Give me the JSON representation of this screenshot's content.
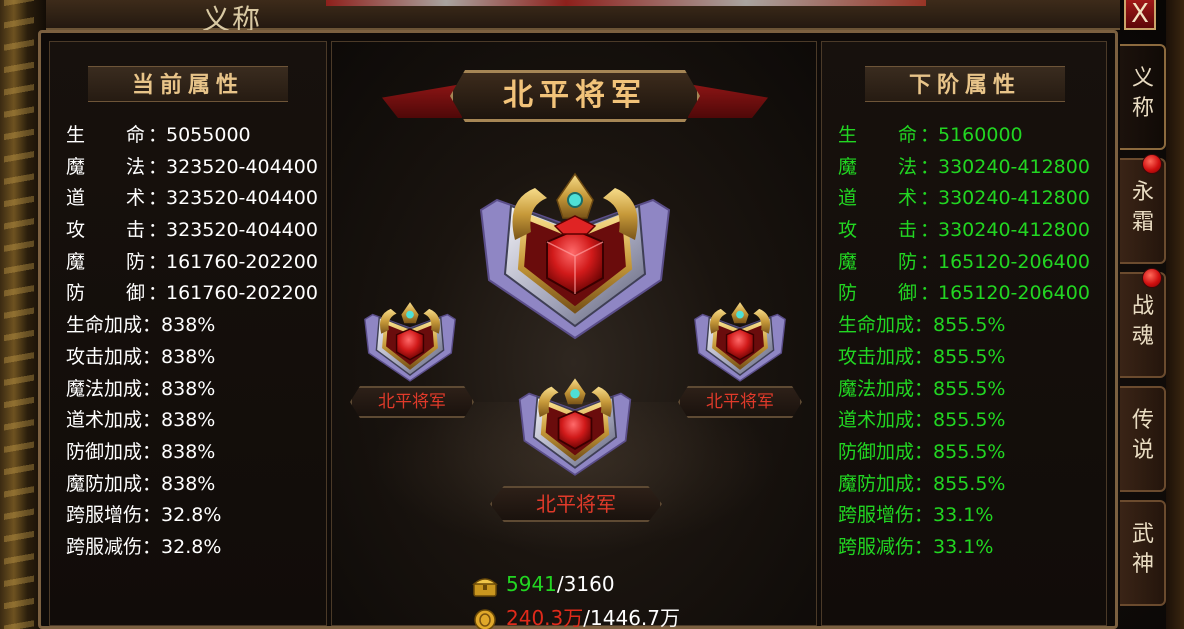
{
  "window": {
    "title": "义称",
    "close_label": "X"
  },
  "current": {
    "header": "当前属性",
    "attrs": [
      {
        "c1": "生",
        "c2": "命",
        "sep": "：",
        "value": "5055000"
      },
      {
        "c1": "魔",
        "c2": "法",
        "sep": "：",
        "value": "323520-404400"
      },
      {
        "c1": "道",
        "c2": "术",
        "sep": "：",
        "value": "323520-404400"
      },
      {
        "c1": "攻",
        "c2": "击",
        "sep": "：",
        "value": "323520-404400"
      },
      {
        "c1": "魔",
        "c2": "防",
        "sep": "：",
        "value": "161760-202200"
      },
      {
        "c1": "防",
        "c2": "御",
        "sep": "：",
        "value": "161760-202200"
      }
    ],
    "bonuses": [
      {
        "label": "生命加成",
        "sep": "：",
        "value": "838%"
      },
      {
        "label": "攻击加成",
        "sep": "：",
        "value": "838%"
      },
      {
        "label": "魔法加成",
        "sep": "：",
        "value": "838%"
      },
      {
        "label": "道术加成",
        "sep": "：",
        "value": "838%"
      },
      {
        "label": "防御加成",
        "sep": "：",
        "value": "838%"
      },
      {
        "label": "魔防加成",
        "sep": "：",
        "value": "838%"
      },
      {
        "label": "跨服增伤",
        "sep": "：",
        "value": "32.8%"
      },
      {
        "label": "跨服减伤",
        "sep": "：",
        "value": "32.8%"
      }
    ]
  },
  "next": {
    "header": "下阶属性",
    "attrs": [
      {
        "c1": "生",
        "c2": "命",
        "sep": "：",
        "value": "5160000"
      },
      {
        "c1": "魔",
        "c2": "法",
        "sep": "：",
        "value": "330240-412800"
      },
      {
        "c1": "道",
        "c2": "术",
        "sep": "：",
        "value": "330240-412800"
      },
      {
        "c1": "攻",
        "c2": "击",
        "sep": "：",
        "value": "330240-412800"
      },
      {
        "c1": "魔",
        "c2": "防",
        "sep": "：",
        "value": "165120-206400"
      },
      {
        "c1": "防",
        "c2": "御",
        "sep": "：",
        "value": "165120-206400"
      }
    ],
    "bonuses": [
      {
        "label": "生命加成",
        "sep": "：",
        "value": "855.5%"
      },
      {
        "label": "攻击加成",
        "sep": "：",
        "value": "855.5%"
      },
      {
        "label": "魔法加成",
        "sep": "：",
        "value": "855.5%"
      },
      {
        "label": "道术加成",
        "sep": "：",
        "value": "855.5%"
      },
      {
        "label": "防御加成",
        "sep": "：",
        "value": "855.5%"
      },
      {
        "label": "魔防加成",
        "sep": "：",
        "value": "855.5%"
      },
      {
        "label": "跨服增伤",
        "sep": "：",
        "value": "33.1%"
      },
      {
        "label": "跨服减伤",
        "sep": "：",
        "value": "33.1%"
      }
    ]
  },
  "center": {
    "rank_title": "北平将军",
    "badge_left_label": "北平将军",
    "badge_right_label": "北平将军",
    "badge_bottom_label": "北平将军",
    "cost_gold": {
      "have": "5941",
      "sep": "/",
      "need": "3160",
      "icon": "gold-chest-icon"
    },
    "cost_coin": {
      "have": "240.3万",
      "sep": "/",
      "need": "1446.7万",
      "icon": "gold-coin-icon"
    }
  },
  "tabs": [
    {
      "label": "义称",
      "active": true,
      "dot": false
    },
    {
      "label": "永霜",
      "active": false,
      "dot": true
    },
    {
      "label": "战魂",
      "active": false,
      "dot": true
    },
    {
      "label": "传说",
      "active": false,
      "dot": false
    },
    {
      "label": "武神",
      "active": false,
      "dot": false
    }
  ],
  "colors": {
    "current_text": "#ffffff",
    "next_text": "#22d622",
    "cost_have_ok": "#22d622",
    "cost_have_short": "#e02a1a",
    "rank_plate_text": "#e03a2a",
    "title_gold": "#f2c37a"
  }
}
